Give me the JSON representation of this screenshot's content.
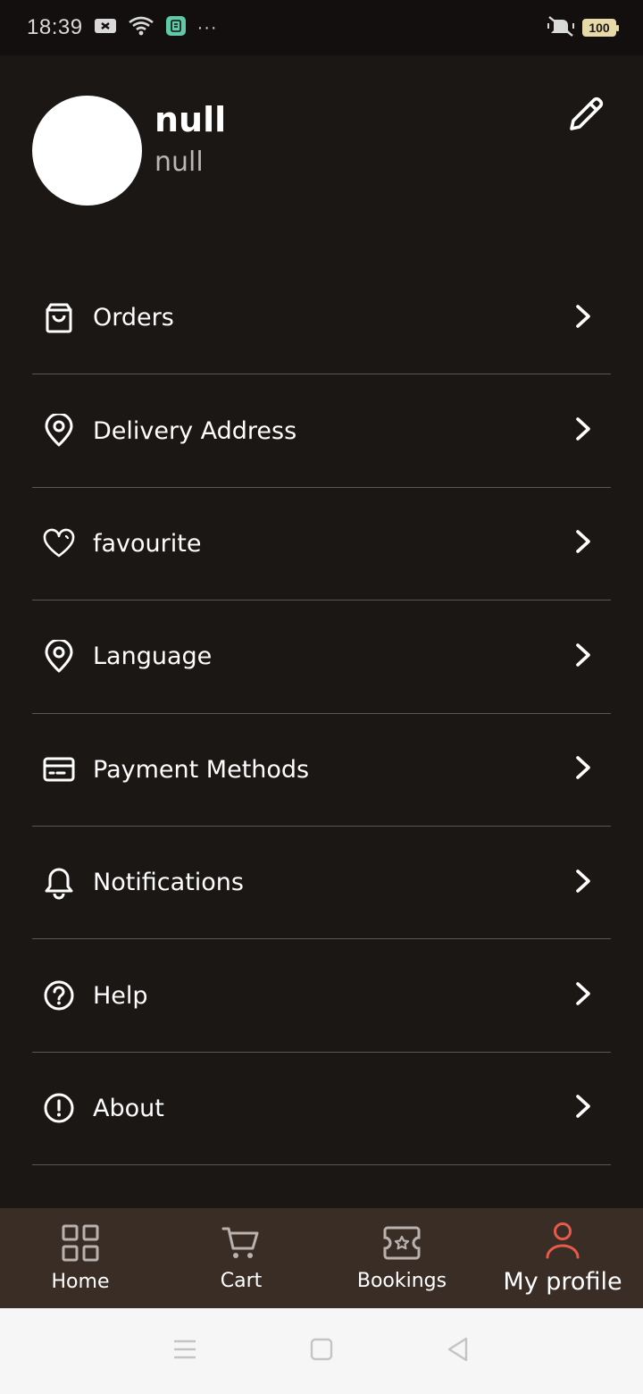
{
  "status_bar": {
    "time": "18:39",
    "battery": "100",
    "more": "···"
  },
  "profile": {
    "name": "null",
    "subtitle": "null"
  },
  "menu": {
    "items": [
      {
        "label": "Orders",
        "icon": "shopping-bag-icon"
      },
      {
        "label": "Delivery Address",
        "icon": "location-pin-icon"
      },
      {
        "label": "favourite",
        "icon": "heart-icon"
      },
      {
        "label": "Language",
        "icon": "location-pin-icon"
      },
      {
        "label": "Payment Methods",
        "icon": "credit-card-icon"
      },
      {
        "label": "Notifications",
        "icon": "bell-icon"
      },
      {
        "label": "Help",
        "icon": "help-circle-icon"
      },
      {
        "label": "About",
        "icon": "alert-circle-icon"
      }
    ]
  },
  "bottom_nav": {
    "items": [
      {
        "label": "Home",
        "icon": "grid-icon"
      },
      {
        "label": "Cart",
        "icon": "cart-icon"
      },
      {
        "label": "Bookings",
        "icon": "ticket-icon"
      },
      {
        "label": "My profile",
        "icon": "user-icon",
        "active": true
      }
    ],
    "active_color": "#e85a4a"
  },
  "colors": {
    "background": "#1b1715",
    "status_bar": "#120f0e",
    "bottom_nav": "#3a2d26",
    "divider": "#5b5654",
    "system_nav": "#f6f6f6"
  }
}
